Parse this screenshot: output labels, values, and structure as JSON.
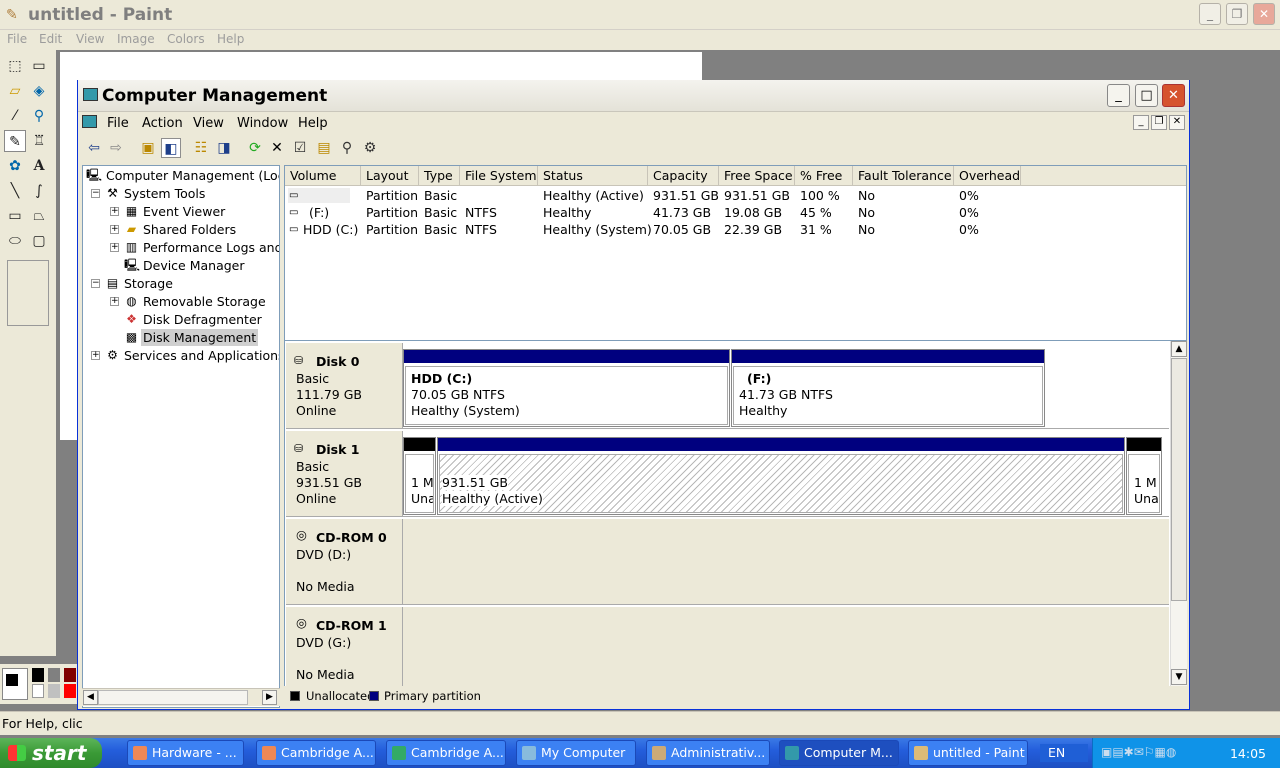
{
  "paint": {
    "title": "untitled - Paint",
    "menu": [
      "File",
      "Edit",
      "View",
      "Image",
      "Colors",
      "Help"
    ],
    "status": "For Help, clic"
  },
  "cm": {
    "title": "Computer Management",
    "menu": [
      "File",
      "Action",
      "View",
      "Window",
      "Help"
    ],
    "tree": {
      "root": "Computer Management (Local",
      "system_tools": "System Tools",
      "event_viewer": "Event Viewer",
      "shared_folders": "Shared Folders",
      "perf_logs": "Performance Logs and /",
      "device_manager": "Device Manager",
      "storage": "Storage",
      "removable_storage": "Removable Storage",
      "disk_defrag": "Disk Defragmenter",
      "disk_management": "Disk Management",
      "services": "Services and Applications"
    },
    "columns": [
      "Volume",
      "Layout",
      "Type",
      "File System",
      "Status",
      "Capacity",
      "Free Space",
      "% Free",
      "Fault Tolerance",
      "Overhead"
    ],
    "volumes": [
      {
        "volume": "",
        "layout": "Partition",
        "type": "Basic",
        "fs": "",
        "status": "Healthy (Active)",
        "capacity": "931.51 GB",
        "free": "931.51 GB",
        "pct": "100 %",
        "fault": "No",
        "overhead": "0%"
      },
      {
        "volume": "(F:)",
        "layout": "Partition",
        "type": "Basic",
        "fs": "NTFS",
        "status": "Healthy",
        "capacity": "41.73 GB",
        "free": "19.08 GB",
        "pct": "45 %",
        "fault": "No",
        "overhead": "0%"
      },
      {
        "volume": "HDD (C:)",
        "layout": "Partition",
        "type": "Basic",
        "fs": "NTFS",
        "status": "Healthy (System)",
        "capacity": "70.05 GB",
        "free": "22.39 GB",
        "pct": "31 %",
        "fault": "No",
        "overhead": "0%"
      }
    ],
    "disks": {
      "disk0": {
        "name": "Disk 0",
        "type": "Basic",
        "size": "111.79 GB",
        "state": "Online",
        "p1": {
          "l1": "HDD  (C:)",
          "l2": "70.05 GB NTFS",
          "l3": "Healthy (System)"
        },
        "p2": {
          "l1": "(F:)",
          "l2": "41.73 GB NTFS",
          "l3": "Healthy"
        }
      },
      "disk1": {
        "name": "Disk 1",
        "type": "Basic",
        "size": "931.51 GB",
        "state": "Online",
        "u1": {
          "l1": "1 M",
          "l2": "Una"
        },
        "p1": {
          "l1": "931.51 GB",
          "l2": "Healthy (Active)"
        },
        "u2": {
          "l1": "1 M",
          "l2": "Una"
        }
      },
      "cd0": {
        "name": "CD-ROM 0",
        "drive": "DVD (D:)",
        "media": "No Media"
      },
      "cd1": {
        "name": "CD-ROM 1",
        "drive": "DVD (G:)",
        "media": "No Media"
      }
    },
    "legend": {
      "unallocated": "Unallocated",
      "primary": "Primary partition"
    }
  },
  "taskbar": {
    "start": "start",
    "tasks": [
      "Hardware - ...",
      "Cambridge A...",
      "Cambridge A...",
      "My Computer",
      "Administrativ...",
      "Computer M...",
      "untitled - Paint"
    ],
    "lang": "EN",
    "time": "14:05"
  },
  "colors": {
    "accent": "#00007f",
    "unallocated": "#000000",
    "taskbar": "#245edc",
    "start": "#3a9a36"
  }
}
